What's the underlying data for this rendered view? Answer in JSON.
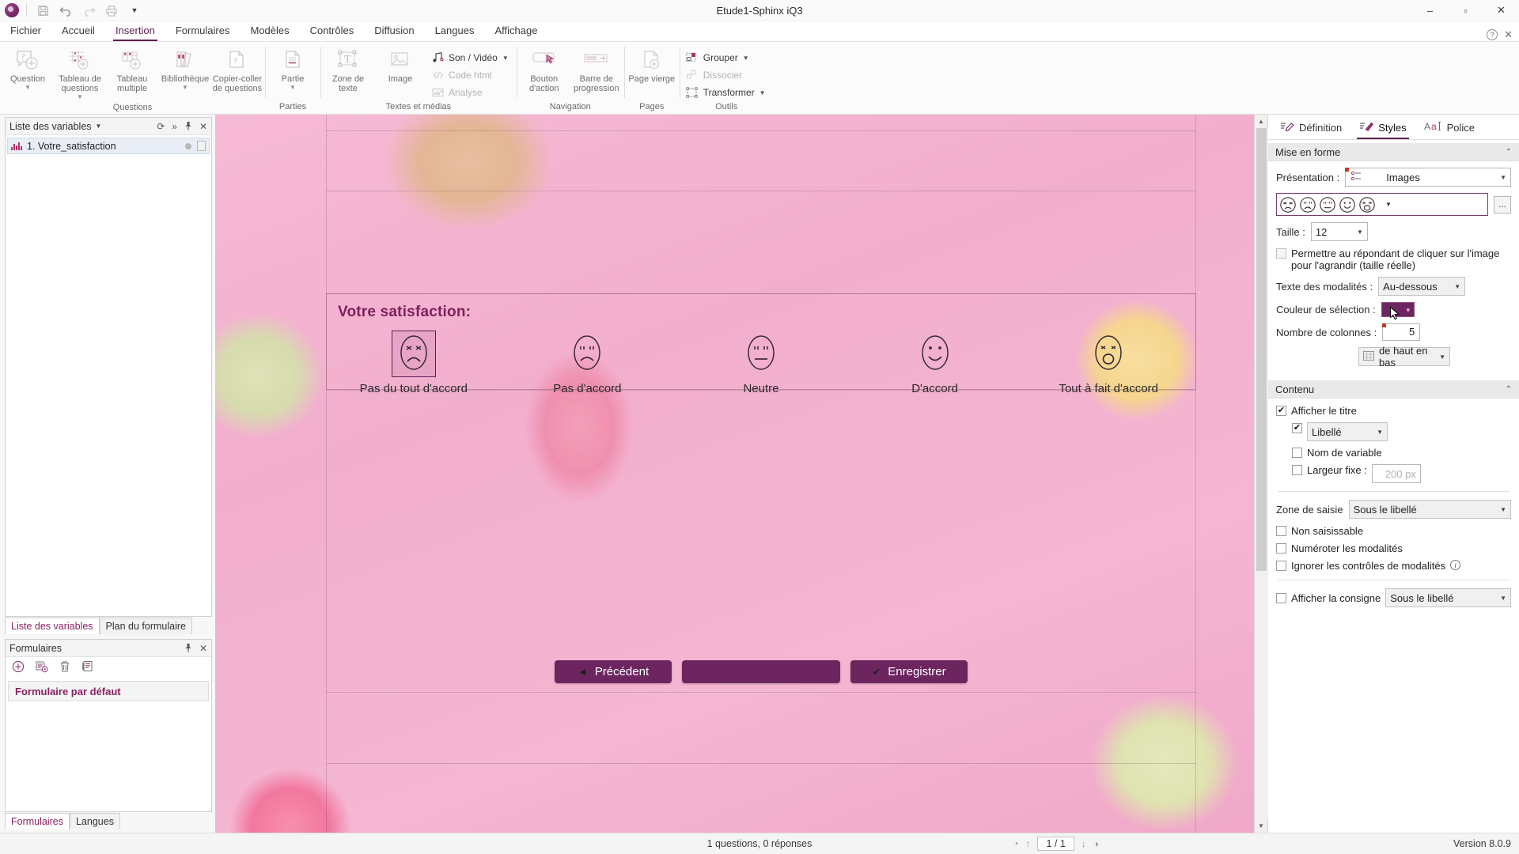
{
  "window": {
    "title": "Etude1-Sphinx iQ3",
    "minimize": "–",
    "maximize": "▫",
    "close": "✕"
  },
  "quick_access": {
    "save": "save-icon",
    "undo": "undo-icon",
    "redo": "redo-icon",
    "print": "print-icon",
    "more": "▼"
  },
  "menu": {
    "tabs": [
      {
        "label": "Fichier",
        "active": false
      },
      {
        "label": "Accueil",
        "active": false
      },
      {
        "label": "Insertion",
        "active": true
      },
      {
        "label": "Formulaires",
        "active": false
      },
      {
        "label": "Modèles",
        "active": false
      },
      {
        "label": "Contrôles",
        "active": false
      },
      {
        "label": "Diffusion",
        "active": false
      },
      {
        "label": "Langues",
        "active": false
      },
      {
        "label": "Affichage",
        "active": false
      }
    ],
    "help": "?",
    "collapse": "✕"
  },
  "ribbon": {
    "groups": [
      {
        "label": "Questions",
        "items": [
          {
            "label": "Question",
            "caret": "▼"
          },
          {
            "label": "Tableau de questions",
            "caret": "▼"
          },
          {
            "label": "Tableau multiple",
            "caret": ""
          },
          {
            "label": "Bibliothèque",
            "caret": "▼"
          },
          {
            "label": "Copier-coller de questions",
            "caret": ""
          }
        ]
      },
      {
        "label": "Parties",
        "items": [
          {
            "label": "Partie",
            "caret": "▼"
          }
        ]
      },
      {
        "label": "Textes et médias",
        "items": [
          {
            "label": "Zone de texte",
            "caret": ""
          },
          {
            "label": "Image",
            "caret": ""
          }
        ],
        "small_items": [
          {
            "label": "Son / Vidéo",
            "caret": "▼",
            "disabled": false
          },
          {
            "label": "Code html",
            "caret": "",
            "disabled": true
          },
          {
            "label": "Analyse",
            "caret": "",
            "disabled": true
          }
        ]
      },
      {
        "label": "Navigation",
        "items": [
          {
            "label": "Bouton d'action",
            "caret": ""
          },
          {
            "label": "Barre de progression",
            "caret": ""
          }
        ]
      },
      {
        "label": "Pages",
        "items": [
          {
            "label": "Page vierge",
            "caret": ""
          }
        ]
      },
      {
        "label": "Outils",
        "small_items": [
          {
            "label": "Grouper",
            "caret": "▼",
            "disabled": false
          },
          {
            "label": "Dissocier",
            "caret": "",
            "disabled": true
          },
          {
            "label": "Transformer",
            "caret": "▼",
            "disabled": false
          }
        ]
      }
    ]
  },
  "left_dock": {
    "variables_panel": {
      "title": "Liste des variables",
      "title_caret": "▼",
      "refresh": "⟳",
      "expand": "»",
      "pin": "📌",
      "close": "✕",
      "rows": [
        {
          "label": "1. Votre_satisfaction"
        }
      ],
      "tabs": [
        {
          "label": "Liste des variables",
          "active": true
        },
        {
          "label": "Plan du formulaire",
          "active": false
        }
      ]
    },
    "forms_panel": {
      "title": "Formulaires",
      "pin": "📌",
      "close": "✕",
      "toolbar": [
        "add-form-icon",
        "duplicate-form-icon",
        "delete-form-icon",
        "properties-form-icon"
      ],
      "items": [
        {
          "label": "Formulaire par défaut"
        }
      ],
      "tabs": [
        {
          "label": "Formulaires",
          "active": true
        },
        {
          "label": "Langues",
          "active": false
        }
      ]
    }
  },
  "canvas": {
    "question": {
      "title": "Votre satisfaction:",
      "modalities": [
        {
          "label": "Pas du tout d'accord",
          "face": "angry",
          "selected": true
        },
        {
          "label": "Pas d'accord",
          "face": "sad",
          "selected": false
        },
        {
          "label": "Neutre",
          "face": "neutral",
          "selected": false
        },
        {
          "label": "D'accord",
          "face": "happy",
          "selected": false
        },
        {
          "label": "Tout à fait d'accord",
          "face": "veryhappy",
          "selected": false
        }
      ]
    },
    "buttons": {
      "previous": "Précédent",
      "middle": "",
      "save": "Enregistrer"
    },
    "accent_color": "#6d2560"
  },
  "right_panel": {
    "tabs": [
      {
        "label": "Définition",
        "icon": "definition-icon",
        "active": false
      },
      {
        "label": "Styles",
        "icon": "styles-icon",
        "active": true
      },
      {
        "label": "Police",
        "icon": "font-icon",
        "active": false
      }
    ],
    "mise_en_forme": {
      "section_title": "Mise en forme",
      "chevron": "⌃",
      "presentation_label": "Présentation :",
      "presentation_value": "Images",
      "smiley_set": [
        "angry",
        "sad",
        "neutral",
        "happy",
        "veryhappy"
      ],
      "smiley_more": "...",
      "taille_label": "Taille :",
      "taille_value": "12",
      "zoom_checkbox": {
        "checked": false,
        "label": "Permettre au répondant de cliquer sur l'image pour l'agrandir (taille réelle)"
      },
      "texte_modalites_label": "Texte des modalités :",
      "texte_modalites_value": "Au-dessous",
      "couleur_selection_label": "Couleur de sélection :",
      "couleur_selection_value": "#6d2560",
      "nombre_colonnes_label": "Nombre de colonnes :",
      "nombre_colonnes_value": "5",
      "ordre_value": "de haut en bas"
    },
    "contenu": {
      "section_title": "Contenu",
      "chevron": "⌃",
      "afficher_titre": {
        "checked": true,
        "label": "Afficher le titre"
      },
      "libelle": {
        "checked": true,
        "value": "Libellé"
      },
      "nom_variable": {
        "checked": false,
        "label": "Nom de variable"
      },
      "largeur_fixe": {
        "checked": false,
        "label": "Largeur fixe :",
        "value": "200 px"
      },
      "zone_saisie_label": "Zone de saisie",
      "zone_saisie_value": "Sous le libellé",
      "non_saisissable": {
        "checked": false,
        "label": "Non saisissable"
      },
      "numeroter": {
        "checked": false,
        "label": "Numéroter les modalités"
      },
      "ignorer": {
        "checked": false,
        "label": "Ignorer les contrôles de modalités",
        "info": "i"
      },
      "afficher_consigne": {
        "checked": false,
        "label": "Afficher la consigne",
        "value": "Sous le libellé"
      }
    }
  },
  "status_bar": {
    "summary": "1 questions, 0 réponses",
    "page": "1 / 1",
    "up": "↑",
    "down": "↓",
    "version": "Version 8.0.9"
  }
}
